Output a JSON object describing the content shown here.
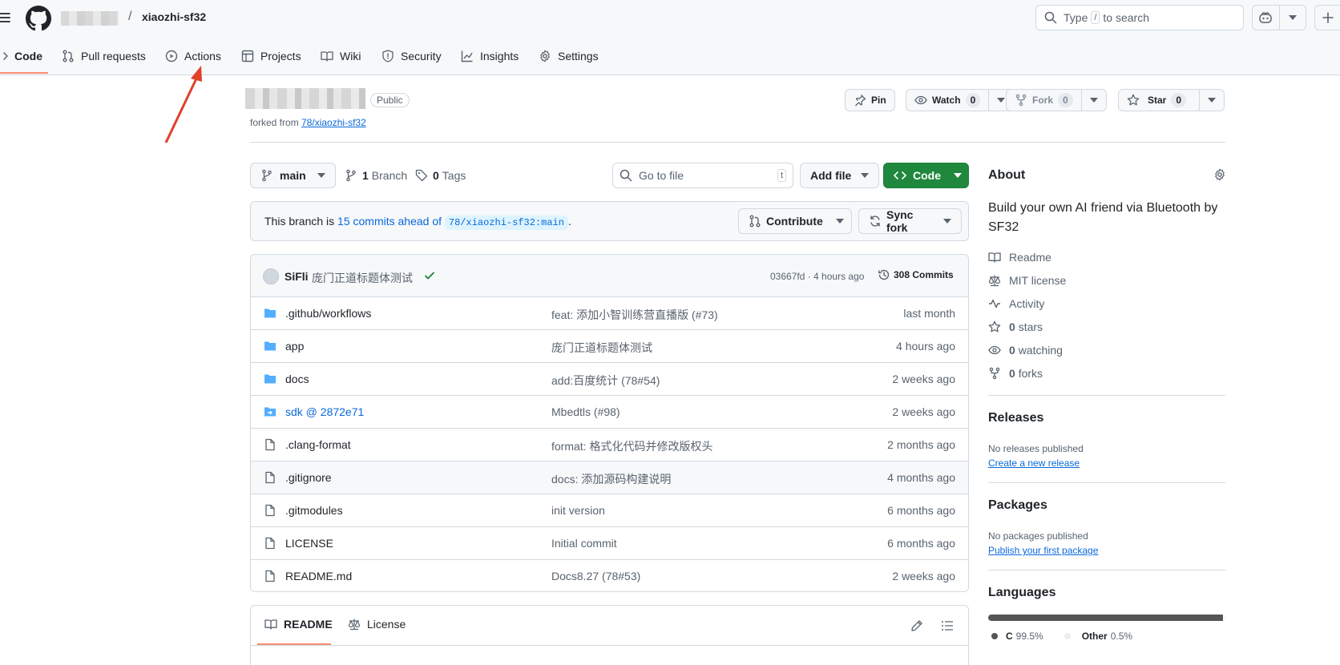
{
  "header": {
    "repo_name": "xiaozhi-sf32",
    "slash": "/",
    "search_prefix": "Type",
    "search_key": "/",
    "search_suffix": "to search"
  },
  "nav": [
    {
      "label": "Code",
      "icon": "code-icon"
    },
    {
      "label": "Pull requests",
      "icon": "pull-request-icon"
    },
    {
      "label": "Actions",
      "icon": "play-icon"
    },
    {
      "label": "Projects",
      "icon": "table-icon"
    },
    {
      "label": "Wiki",
      "icon": "book-icon"
    },
    {
      "label": "Security",
      "icon": "shield-icon"
    },
    {
      "label": "Insights",
      "icon": "graph-icon"
    },
    {
      "label": "Settings",
      "icon": "gear-icon"
    }
  ],
  "repo": {
    "visibility": "Public",
    "forked_prefix": "forked from",
    "forked_link": "78/xiaozhi-sf32",
    "pin": "Pin",
    "watch": "Watch",
    "watch_count": "0",
    "fork": "Fork",
    "fork_count": "0",
    "star": "Star",
    "star_count": "0"
  },
  "branch_bar": {
    "branch": "main",
    "branches_count": "1",
    "branches_label": "Branch",
    "tags_count": "0",
    "tags_label": "Tags",
    "goto_placeholder": "Go to file",
    "goto_key": "t",
    "add_file": "Add file",
    "code": "Code"
  },
  "ahead": {
    "prefix": "This branch is",
    "link": "15 commits ahead of",
    "ref": "78/xiaozhi-sf32:main",
    "suffix": ".",
    "contribute": "Contribute",
    "sync": "Sync fork"
  },
  "latest_commit": {
    "author": "SiFli",
    "message": "庞门正道标题体测试",
    "meta": "03667fd · 4 hours ago",
    "commits": "308 Commits"
  },
  "files": [
    {
      "name": ".github/workflows",
      "type": "folder",
      "message": "feat: 添加小智训练营直播版 (#73)",
      "date": "last month"
    },
    {
      "name": "app",
      "type": "folder",
      "message": "庞门正道标题体测试",
      "date": "4 hours ago"
    },
    {
      "name": "docs",
      "type": "folder",
      "message": "add:百度统计 (78#54)",
      "date": "2 weeks ago"
    },
    {
      "name": "sdk @ 2872e71",
      "type": "submodule",
      "message": "Mbedtls (#98)",
      "date": "2 weeks ago"
    },
    {
      "name": ".clang-format",
      "type": "file",
      "message": "format: 格式化代码并修改版权头",
      "date": "2 months ago"
    },
    {
      "name": ".gitignore",
      "type": "file",
      "message": "docs: 添加源码构建说明",
      "date": "4 months ago"
    },
    {
      "name": ".gitmodules",
      "type": "file",
      "message": "init version",
      "date": "6 months ago"
    },
    {
      "name": "LICENSE",
      "type": "file",
      "message": "Initial commit",
      "date": "6 months ago"
    },
    {
      "name": "README.md",
      "type": "file",
      "message": "Docs8.27 (78#53)",
      "date": "2 weeks ago"
    }
  ],
  "readme": {
    "tab_readme": "README",
    "tab_license": "License"
  },
  "about": {
    "title": "About",
    "description": "Build your own AI friend via Bluetooth by SF32",
    "readme": "Readme",
    "license": "MIT license",
    "activity": "Activity",
    "stars_count": "0",
    "stars": "stars",
    "watching_count": "0",
    "watching": "watching",
    "forks_count": "0",
    "forks": "forks"
  },
  "releases": {
    "title": "Releases",
    "none": "No releases published",
    "create": "Create a new release"
  },
  "packages": {
    "title": "Packages",
    "none": "No packages published",
    "publish": "Publish your first package"
  },
  "languages": {
    "title": "Languages",
    "items": [
      {
        "name": "C",
        "percent": "99.5%",
        "value": 99.5,
        "color": "#555555"
      },
      {
        "name": "Other",
        "percent": "0.5%",
        "value": 0.5,
        "color": "#ededed"
      }
    ]
  },
  "colors": {
    "accent": "#0969da",
    "primary_button": "#1f883d",
    "tab_underline": "#fd8c73",
    "annotation_arrow": "#e0402a"
  }
}
